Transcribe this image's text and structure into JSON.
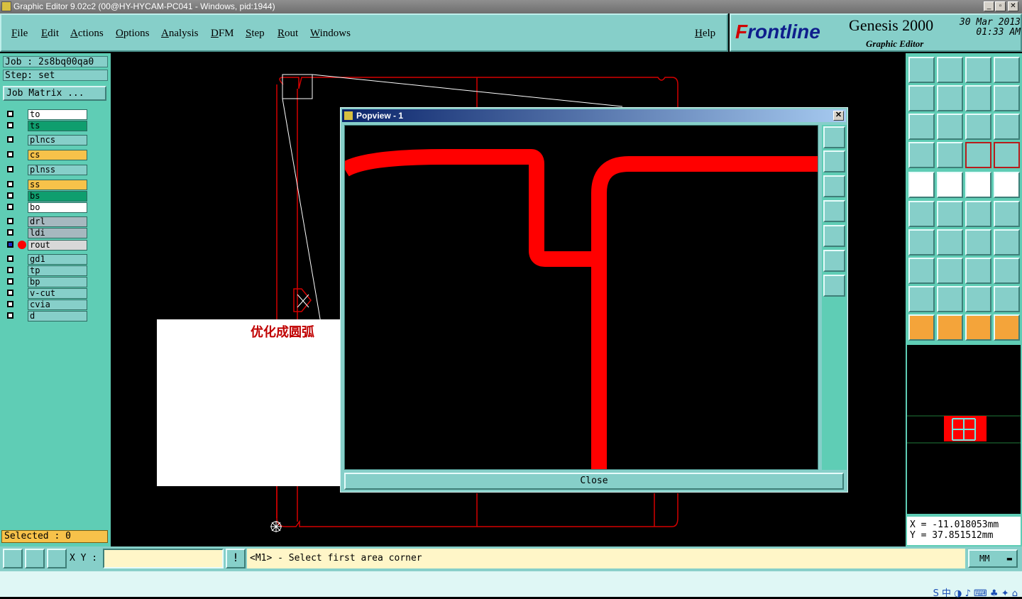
{
  "window": {
    "title": "Graphic Editor 9.02c2 (00@HY-HYCAM-PC041 - Windows, pid:1944)"
  },
  "menu": [
    "File",
    "Edit",
    "Actions",
    "Options",
    "Analysis",
    "DFM",
    "Step",
    "Rout",
    "Windows"
  ],
  "help": "Help",
  "brand": {
    "logo_prefix": "F",
    "logo_rest": "rontline",
    "product": "Genesis 2000",
    "subtitle": "Graphic Editor",
    "date": "30 Mar 2013",
    "time": "01:33 AM"
  },
  "job": {
    "job_line": "Job : 2s8bq00qa0",
    "step_line": "Step: set",
    "matrix_button": "Job Matrix ..."
  },
  "layers": [
    {
      "name": "to",
      "color": "#ffffff"
    },
    {
      "name": "ts",
      "color": "#0f9e6e"
    },
    {
      "name": "plncs",
      "color": "#86cfc9"
    },
    {
      "name": "cs",
      "color": "#f7c24a"
    },
    {
      "name": "plnss",
      "color": "#86cfc9"
    },
    {
      "name": "ss",
      "color": "#f7c24a"
    },
    {
      "name": "bs",
      "color": "#0f9e6e"
    },
    {
      "name": "bo",
      "color": "#ffffff"
    },
    {
      "name": "drl",
      "color": "#a6b8bf"
    },
    {
      "name": "ldi",
      "color": "#a6b8bf"
    },
    {
      "name": "rout",
      "color": "#d8d8d8"
    },
    {
      "name": "gd1",
      "color": "#86cfc9"
    },
    {
      "name": "tp",
      "color": "#86cfc9"
    },
    {
      "name": "bp",
      "color": "#86cfc9"
    },
    {
      "name": "v-cut",
      "color": "#86cfc9"
    },
    {
      "name": "cvia",
      "color": "#86cfc9"
    },
    {
      "name": "d",
      "color": "#86cfc9"
    }
  ],
  "selected": "Selected : 0",
  "popview": {
    "title": "Popview - 1",
    "close": "Close"
  },
  "annotation": "优化成圆弧",
  "coords": {
    "x": "X = -11.018053mm",
    "y": "Y = 37.851512mm"
  },
  "status": {
    "xy_label": "X Y :",
    "prompt": "<M1> - Select first area corner",
    "units": "MM"
  },
  "colors": {
    "trace": "#ff0000",
    "outline": "#d40000",
    "arrow": "#ffff33",
    "panel": "#86cfc9",
    "frame": "#5fcdb5"
  }
}
